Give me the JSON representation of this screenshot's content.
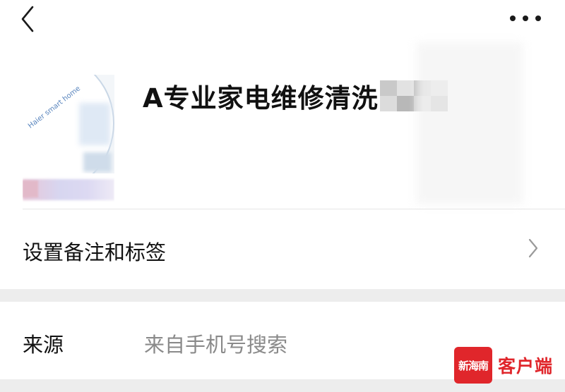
{
  "header": {
    "back_icon": "chevron-left-icon",
    "more_icon": "more-horizontal-icon"
  },
  "profile": {
    "avatar_brand": "Haier smart home",
    "name_visible": "A专业家电维修清洗",
    "name_obscured": true
  },
  "rows": {
    "remark_label": "设置备注和标签",
    "remark_icon": "chevron-right-icon",
    "source_label": "来源",
    "source_value": "来自手机号搜索"
  },
  "watermark": {
    "logo_text": "新海南",
    "text": "客户端",
    "color": "#e0262b"
  },
  "colors": {
    "background": "#ffffff",
    "section_gap": "#ededed",
    "secondary_text": "#8a8a8a"
  }
}
